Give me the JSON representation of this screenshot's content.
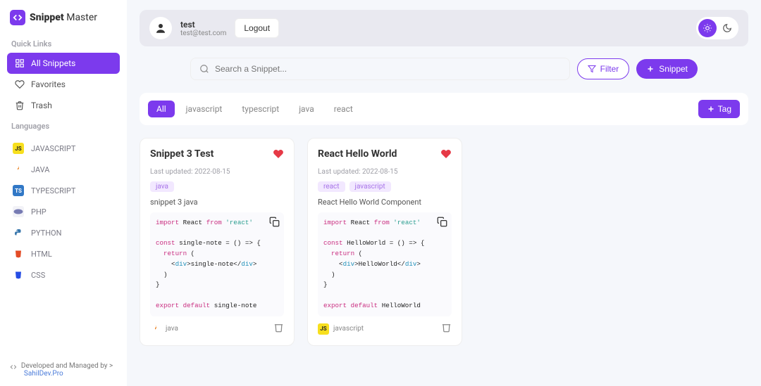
{
  "brand": {
    "strong": "Snippet",
    "light": "Master"
  },
  "sidebar": {
    "quick_links_label": "Quick Links",
    "languages_label": "Languages",
    "nav": {
      "all_snippets": "All Snippets",
      "favorites": "Favorites",
      "trash": "Trash"
    },
    "langs": [
      {
        "label": "JAVASCRIPT",
        "badge": "JS",
        "cls": "js-b"
      },
      {
        "label": "JAVA",
        "badge": "",
        "cls": "java-b"
      },
      {
        "label": "TYPESCRIPT",
        "badge": "TS",
        "cls": "ts-b"
      },
      {
        "label": "PHP",
        "badge": "",
        "cls": "php-b"
      },
      {
        "label": "PYTHON",
        "badge": "",
        "cls": "py-b"
      },
      {
        "label": "HTML",
        "badge": "",
        "cls": "html-b"
      },
      {
        "label": "CSS",
        "badge": "",
        "cls": "css-b"
      }
    ]
  },
  "footer": {
    "text": "Developed and Managed by >",
    "link": "SahilDev.Pro"
  },
  "header": {
    "username": "test",
    "email": "test@test.com",
    "logout": "Logout"
  },
  "search": {
    "placeholder": "Search a Snippet...",
    "filter": "Filter",
    "snippet": "Snippet"
  },
  "tags": {
    "items": [
      "All",
      "javascript",
      "typescript",
      "java",
      "react"
    ],
    "active_index": 0,
    "add_label": "Tag"
  },
  "cards": [
    {
      "title": "Snippet 3 Test",
      "updated": "Last updated: 2022-08-15",
      "tags": [
        "java"
      ],
      "desc": "snippet 3 java",
      "lang_label": "java",
      "lang_badge": "",
      "lang_cls": "java-b"
    },
    {
      "title": "React Hello World",
      "updated": "Last updated: 2022-08-15",
      "tags": [
        "react",
        "javascript"
      ],
      "desc": "React Hello World Component",
      "lang_label": "javascript",
      "lang_badge": "JS",
      "lang_cls": "js-b"
    }
  ],
  "colors": {
    "accent": "#7c3aed",
    "heart": "#e63946"
  }
}
